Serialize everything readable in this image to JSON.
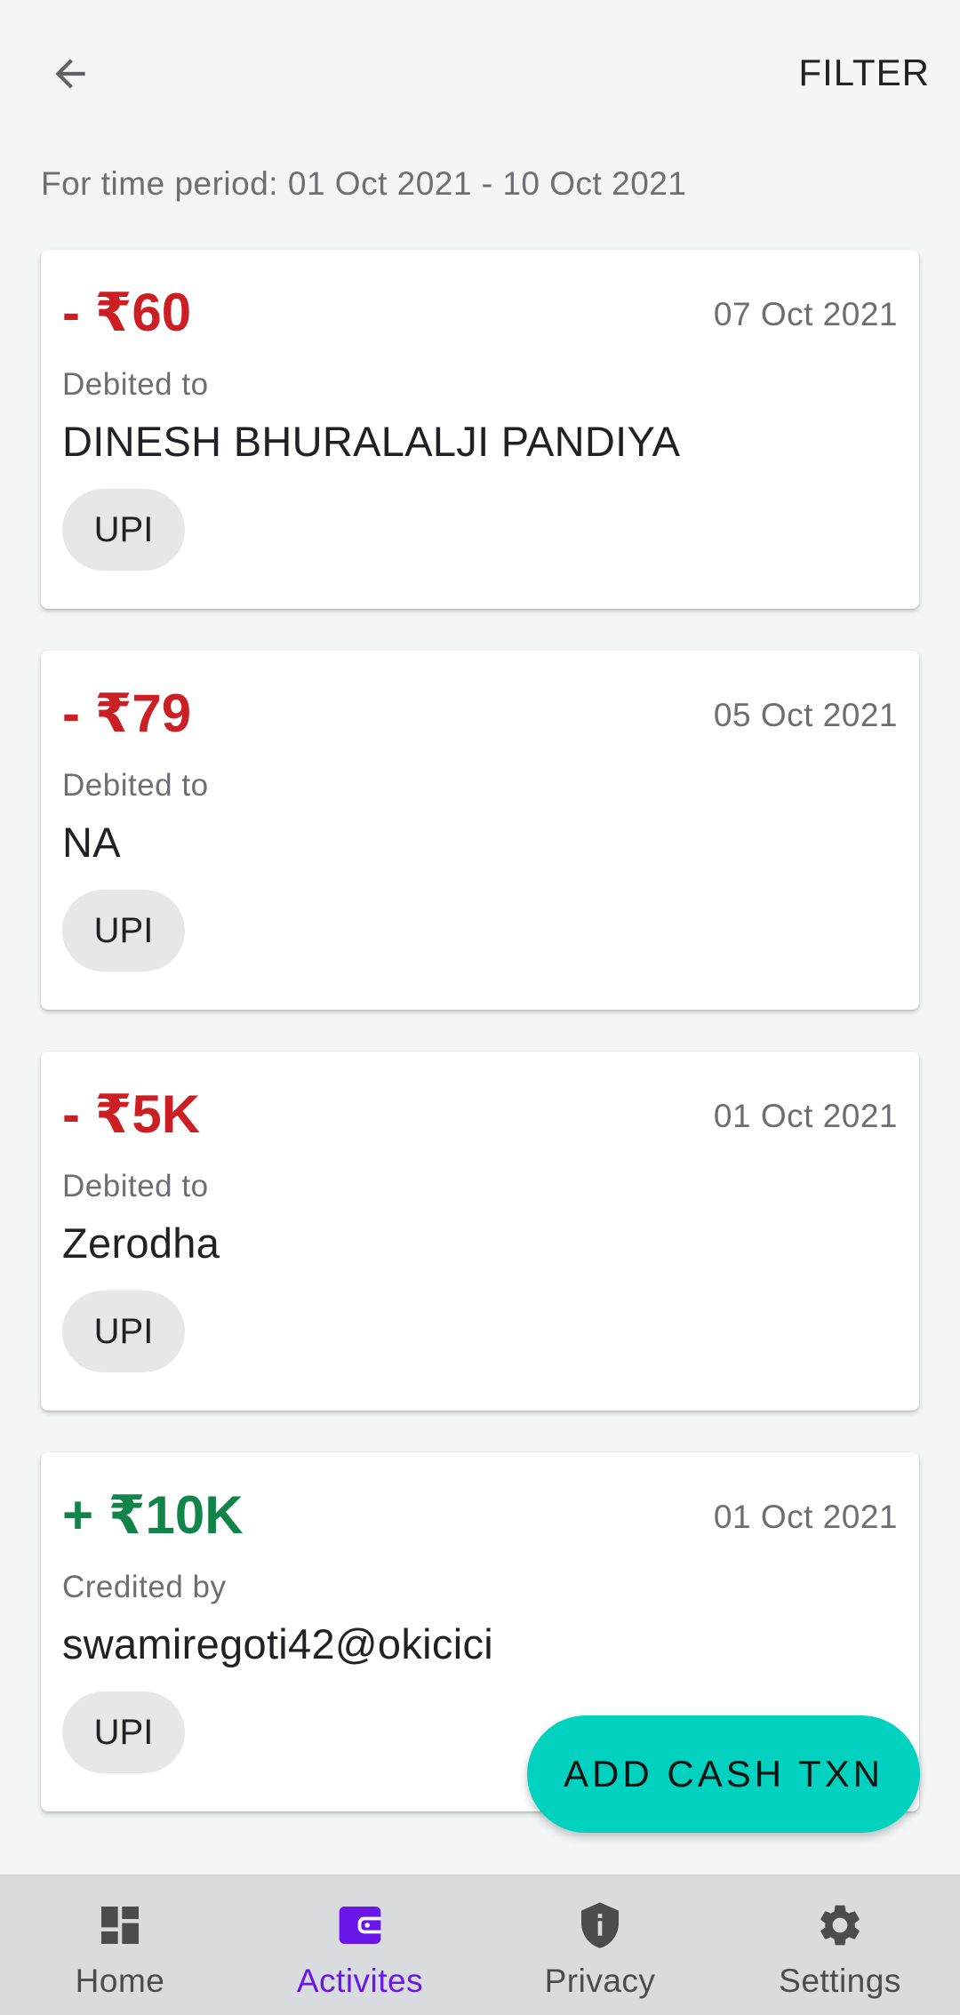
{
  "header": {
    "back_icon": "arrow-left-icon",
    "filter_label": "FILTER"
  },
  "period_text": "For time period: 01 Oct 2021 - 10 Oct 2021",
  "transactions": [
    {
      "amount": "- ₹60",
      "type": "debit",
      "date": "07 Oct 2021",
      "direction_label": "Debited to",
      "party": "DINESH BHURALALJI PANDIYA",
      "method": "UPI"
    },
    {
      "amount": "- ₹79",
      "type": "debit",
      "date": "05 Oct 2021",
      "direction_label": "Debited to",
      "party": "NA",
      "method": "UPI"
    },
    {
      "amount": "- ₹5K",
      "type": "debit",
      "date": "01 Oct 2021",
      "direction_label": "Debited to",
      "party": "Zerodha",
      "method": "UPI"
    },
    {
      "amount": "+ ₹10K",
      "type": "credit",
      "date": "01 Oct 2021",
      "direction_label": "Credited by",
      "party": "swamiregoti42@okicici",
      "method": "UPI"
    }
  ],
  "fab": {
    "label": "ADD CASH TXN"
  },
  "bottom_nav": [
    {
      "label": "Home",
      "icon": "dashboard-icon",
      "active": false
    },
    {
      "label": "Activites",
      "icon": "wallet-icon",
      "active": true
    },
    {
      "label": "Privacy",
      "icon": "shield-info-icon",
      "active": false
    },
    {
      "label": "Settings",
      "icon": "gear-icon",
      "active": false
    }
  ],
  "colors": {
    "debit": "#cc1f24",
    "credit": "#11844a",
    "accent": "#6a16e8",
    "fab": "#00d2bf",
    "background": "#f3f6f7"
  }
}
